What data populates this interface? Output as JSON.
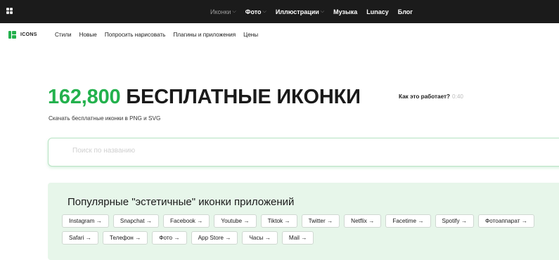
{
  "topnav": {
    "items": [
      {
        "label": "Иконки",
        "has_dropdown": true,
        "active": false
      },
      {
        "label": "Фото",
        "has_dropdown": true,
        "active": true
      },
      {
        "label": "Иллюстрации",
        "has_dropdown": true,
        "active": true
      },
      {
        "label": "Музыка",
        "has_dropdown": false,
        "active": true
      },
      {
        "label": "Lunacy",
        "has_dropdown": false,
        "active": true
      },
      {
        "label": "Блог",
        "has_dropdown": false,
        "active": true
      }
    ],
    "chevron": "⌵"
  },
  "brand": {
    "name": "ICONS",
    "color": "#23b14d"
  },
  "subnav": {
    "items": [
      "Стили",
      "Новые",
      "Попросить нарисовать",
      "Плагины и приложения",
      "Цены"
    ]
  },
  "hero": {
    "count": "162,800",
    "title_rest": " БЕСПЛАТНЫЕ ИКОНКИ",
    "subtitle": "Скачать бесплатные иконки в PNG и SVG",
    "how_label": "Как это работает?",
    "how_time": "0:40"
  },
  "search": {
    "placeholder": "Поиск по названию"
  },
  "popular": {
    "heading": "Популярные \"эстетичные\" иконки приложений",
    "chips": [
      "Instagram →",
      "Snapchat →",
      "Facebook →",
      "Youtube →",
      "Tiktok →",
      "Twitter →",
      "Netflix →",
      "Facetime →",
      "Spotify →",
      "Фотоаппарат →",
      "Safari →",
      "Телефон →",
      "Фото →",
      "App Store →",
      "Часы →",
      "Mail →"
    ]
  },
  "colors": {
    "accent": "#23b14d",
    "topbar": "#1b1b1b",
    "popular_bg": "#e7f6ea"
  }
}
